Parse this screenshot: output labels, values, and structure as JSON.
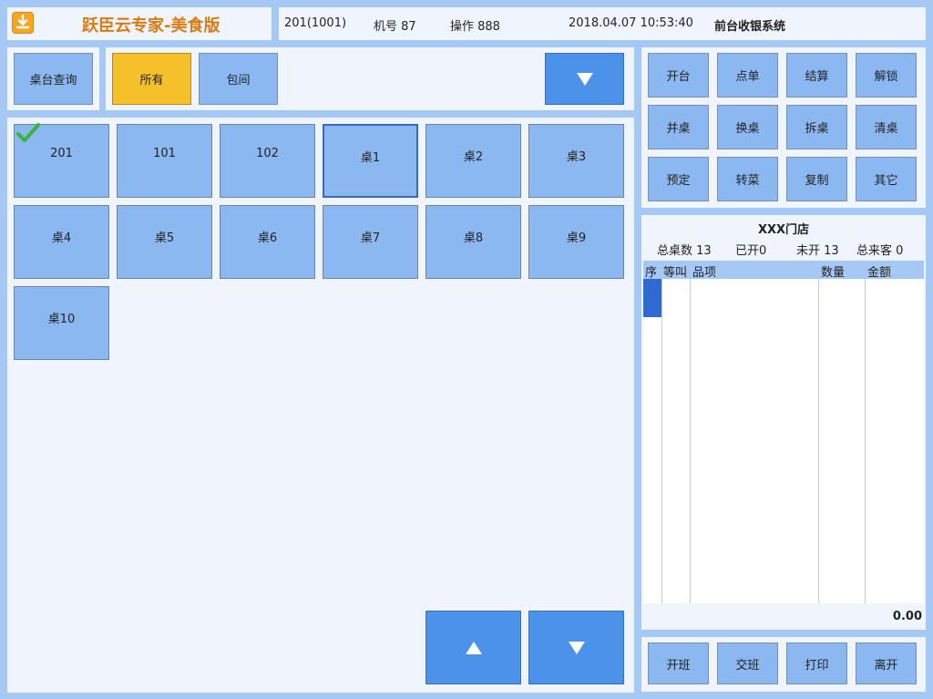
{
  "app": {
    "title": "跃臣云专家-美食版",
    "logo_icon": "download-icon"
  },
  "info": {
    "table_code": "201(1001)",
    "machine": "机号 87",
    "operator": "操作 888",
    "datetime": "2018.04.07 10:53:40",
    "system_name": "前台收银系统"
  },
  "search": {
    "label": "桌台查询"
  },
  "filters": {
    "all": "所有",
    "private_room": "包间",
    "dropdown_icon": "triangle-down-icon"
  },
  "tables": [
    "201",
    "101",
    "102",
    "桌1",
    "桌2",
    "桌3",
    "桌4",
    "桌5",
    "桌6",
    "桌7",
    "桌8",
    "桌9",
    "桌10"
  ],
  "pager": {
    "up_icon": "triangle-up-icon",
    "down_icon": "triangle-down-icon"
  },
  "actions": [
    "开台",
    "点单",
    "结算",
    "解锁",
    "并桌",
    "换桌",
    "拆桌",
    "清桌",
    "预定",
    "转菜",
    "复制",
    "其它"
  ],
  "store": {
    "name": "XXX门店",
    "total_tables": "总桌数 13",
    "opened": "已开0",
    "not_opened": "未开 13",
    "total_guests": "总来客 0"
  },
  "list": {
    "col_seq": "序",
    "col_call": "等叫",
    "col_item": "品项",
    "col_qty": "数量",
    "col_amount": "金额",
    "total": "0.00"
  },
  "bottom_actions": [
    "开班",
    "交班",
    "打印",
    "离开"
  ],
  "colors": {
    "accent_blue": "#4c92ea",
    "selected_yellow": "#f6c02a",
    "title_orange": "#d97b12"
  }
}
